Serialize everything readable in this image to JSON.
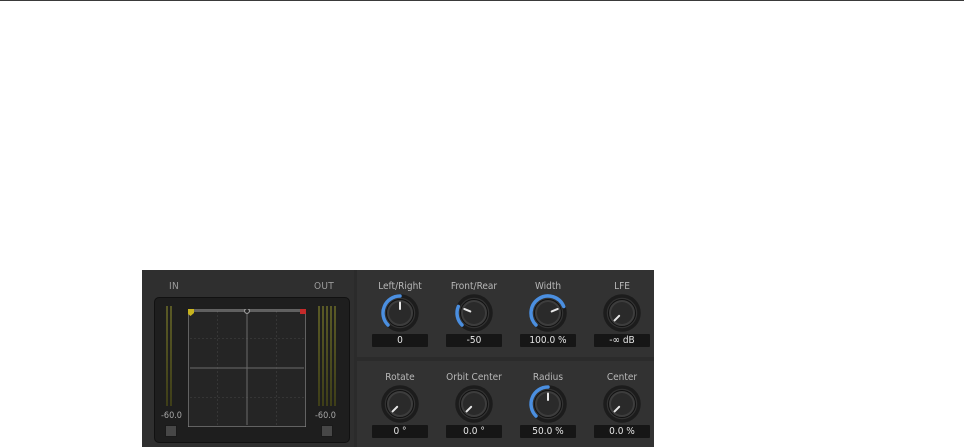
{
  "meters": {
    "in_label": "IN",
    "out_label": "OUT",
    "in_value": "-60.0",
    "out_value": "-60.0"
  },
  "knobs_top": [
    {
      "label": "Left/Right",
      "value": "0",
      "arc_fraction": 0.5
    },
    {
      "label": "Front/Rear",
      "value": "-50",
      "arc_fraction": 0.25
    },
    {
      "label": "Width",
      "value": "100.0 %",
      "arc_fraction": 0.75
    },
    {
      "label": "LFE",
      "value": "-∞ dB",
      "arc_fraction": 0.0
    }
  ],
  "knobs_bottom": [
    {
      "label": "Rotate",
      "value": "0 °",
      "arc_fraction": 0.0
    },
    {
      "label": "Orbit Center",
      "value": "0.0 °",
      "arc_fraction": 0.0
    },
    {
      "label": "Radius",
      "value": "50.0 %",
      "arc_fraction": 0.5
    },
    {
      "label": "Center",
      "value": "0.0 %",
      "arc_fraction": 0.0
    }
  ],
  "colors": {
    "accent_arc": "#4b8fe0",
    "left_handle": "#c8b41e",
    "right_handle": "#c42a2a"
  }
}
